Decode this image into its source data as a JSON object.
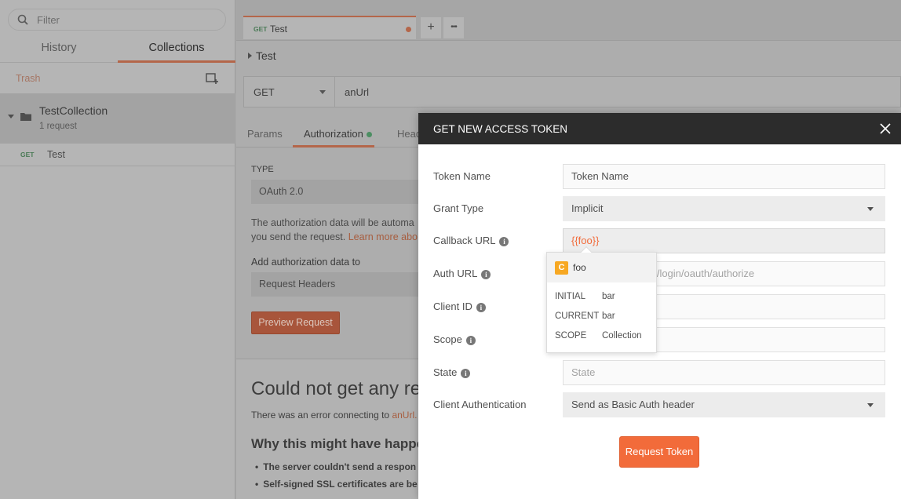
{
  "sidebar": {
    "filter_placeholder": "Filter",
    "tabs": [
      {
        "label": "History"
      },
      {
        "label": "Collections"
      }
    ],
    "trash_label": "Trash",
    "collection": {
      "name": "TestCollection",
      "meta": "1 request",
      "requests": [
        {
          "method": "GET",
          "name": "Test"
        }
      ]
    }
  },
  "main": {
    "tab": {
      "method": "GET",
      "name": "Test"
    },
    "tab_add": "+",
    "tab_more": "•••",
    "breadcrumb": "Test",
    "request": {
      "method": "GET",
      "url": "anUrl"
    },
    "subtabs": [
      "Params",
      "Authorization",
      "Head"
    ],
    "auth": {
      "type_label": "TYPE",
      "type_value": "OAuth 2.0",
      "description_1": "The authorization data will be automa",
      "description_2": "you send the request.",
      "learn_more": "Learn more abo",
      "add_to_label": "Add authorization data to",
      "add_to_value": "Request Headers",
      "preview_button": "Preview Request"
    },
    "response": {
      "title": "Could not get any re",
      "error_prefix": "There was an error connecting to",
      "error_link": "anUrl.",
      "why_title": "Why this might have happe",
      "reasons": [
        "The server couldn't send a respon",
        "Self-signed SSL certificates are be"
      ]
    }
  },
  "modal": {
    "title": "GET NEW ACCESS TOKEN",
    "fields": {
      "token_name": {
        "label": "Token Name",
        "value": "Token Name"
      },
      "grant_type": {
        "label": "Grant Type",
        "value": "Implicit"
      },
      "callback_url": {
        "label": "Callback URL",
        "value": "{{foo}}"
      },
      "auth_url": {
        "label": "Auth URL",
        "value": "m/login/oauth/authorize"
      },
      "client_id": {
        "label": "Client ID",
        "value": ""
      },
      "scope": {
        "label": "Scope",
        "value": ""
      },
      "state": {
        "label": "State",
        "placeholder": "State"
      },
      "client_auth": {
        "label": "Client Authentication",
        "value": "Send as Basic Auth header"
      }
    },
    "submit_button": "Request Token"
  },
  "variable_popover": {
    "badge": "C",
    "name": "foo",
    "rows": [
      {
        "key": "INITIAL",
        "value": "bar"
      },
      {
        "key": "CURRENT",
        "value": "bar"
      },
      {
        "key": "SCOPE",
        "value": "Collection"
      }
    ]
  },
  "colors": {
    "accent": "#f26b3a",
    "variable_badge": "#f7a823",
    "modal_header": "#2c2c2c",
    "status_green": "#4c8e62"
  }
}
